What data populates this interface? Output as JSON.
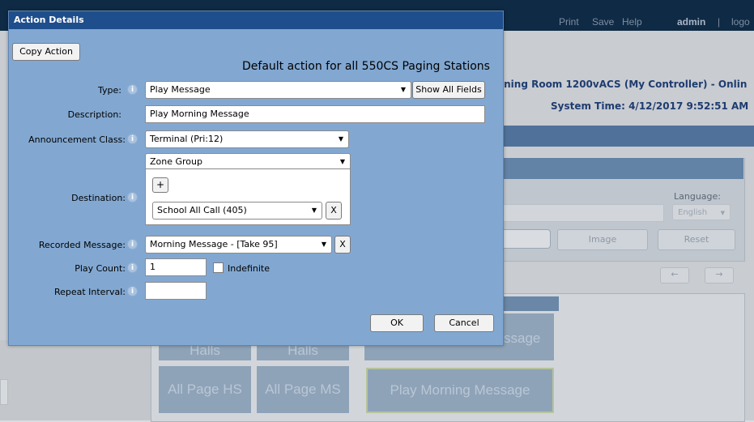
{
  "background": {
    "nav": {
      "print": "Print",
      "save": "Save",
      "help": "Help",
      "user": "admin",
      "separator": "|",
      "logout": "logo"
    },
    "controller_title": "ining Room 1200vACS (My Controller) - Onlin",
    "system_time": "System Time: 4/12/2017 9:52:51 AM",
    "language_label": "Language:",
    "language_value": "English",
    "image_button": "Image",
    "reset_button": "Reset",
    "left_arrow": "←",
    "right_arrow": "→",
    "tiles": [
      {
        "label": "Halls"
      },
      {
        "label": "Halls"
      },
      {
        "label": "ssage"
      },
      {
        "label": "All Page HS"
      },
      {
        "label": "All Page MS"
      },
      {
        "label": "Play Morning Message"
      }
    ]
  },
  "modal": {
    "title": "Action Details",
    "copy_action": "Copy Action",
    "heading": "Default action for all 550CS Paging Stations",
    "type": {
      "label": "Type:",
      "value": "Play Message",
      "show_all": "Show All Fields"
    },
    "description": {
      "label": "Description:",
      "value": "Play Morning Message"
    },
    "announcement_class": {
      "label": "Announcement Class:",
      "value": "Terminal (Pri:12)"
    },
    "destination": {
      "label": "Destination:",
      "group_type": "Zone Group",
      "add": "+",
      "value": "School All Call (405)",
      "remove": "X"
    },
    "recorded_message": {
      "label": "Recorded Message:",
      "value": "Morning Message - [Take 95]",
      "remove": "X"
    },
    "play_count": {
      "label": "Play Count:",
      "value": "1",
      "indefinite_label": "Indefinite"
    },
    "repeat_interval": {
      "label": "Repeat Interval:",
      "value": ""
    },
    "ok": "OK",
    "cancel": "Cancel"
  },
  "colors": {
    "modal_bg": "#82a8d2",
    "modal_header": "#1f4e8c",
    "topbar": "#0f2a44"
  }
}
